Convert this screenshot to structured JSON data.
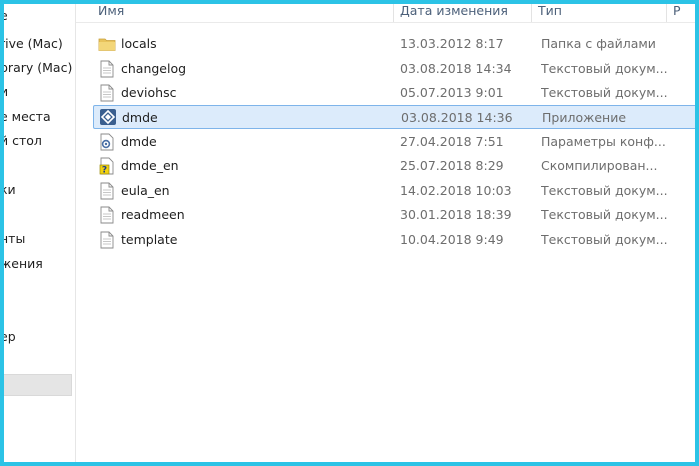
{
  "sidebar": {
    "items": [
      {
        "label": "е"
      },
      {
        "label": "rive (Mac)"
      },
      {
        "label": "brary (Mac)"
      },
      {
        "label": "и"
      },
      {
        "label": "е места"
      },
      {
        "label": "й стол"
      },
      {
        "label": ""
      },
      {
        "label": "ки"
      },
      {
        "label": ""
      },
      {
        "label": "нты"
      },
      {
        "label": "жения"
      },
      {
        "label": ""
      },
      {
        "label": ""
      },
      {
        "label": "ер"
      }
    ]
  },
  "columns": {
    "name": "Имя",
    "date": "Дата изменения",
    "type": "Тип",
    "size": "Р"
  },
  "files": [
    {
      "name": "locals",
      "date": "13.03.2012 8:17",
      "type": "Папка с файлами",
      "icon": "folder-icon"
    },
    {
      "name": "changelog",
      "date": "03.08.2018 14:34",
      "type": "Текстовый докум...",
      "icon": "text-document-icon"
    },
    {
      "name": "deviohsc",
      "date": "05.07.2013 9:01",
      "type": "Текстовый докум...",
      "icon": "text-document-icon"
    },
    {
      "name": "dmde",
      "date": "03.08.2018 14:36",
      "type": "Приложение",
      "icon": "dmde-app-icon"
    },
    {
      "name": "dmde",
      "date": "27.04.2018 7:51",
      "type": "Параметры конф...",
      "icon": "config-settings-icon"
    },
    {
      "name": "dmde_en",
      "date": "25.07.2018 8:29",
      "type": "Скомпилирован...",
      "icon": "compiled-help-icon"
    },
    {
      "name": "eula_en",
      "date": "14.02.2018 10:03",
      "type": "Текстовый докум...",
      "icon": "text-document-icon"
    },
    {
      "name": "readmeen",
      "date": "30.01.2018 18:39",
      "type": "Текстовый докум...",
      "icon": "text-document-icon"
    },
    {
      "name": "template",
      "date": "10.04.2018 9:49",
      "type": "Текстовый докум...",
      "icon": "text-document-icon"
    }
  ],
  "selection": {
    "accent": "#7eb4ea",
    "fill": "#dcebfb"
  },
  "frame_color": "#2cc3e6"
}
